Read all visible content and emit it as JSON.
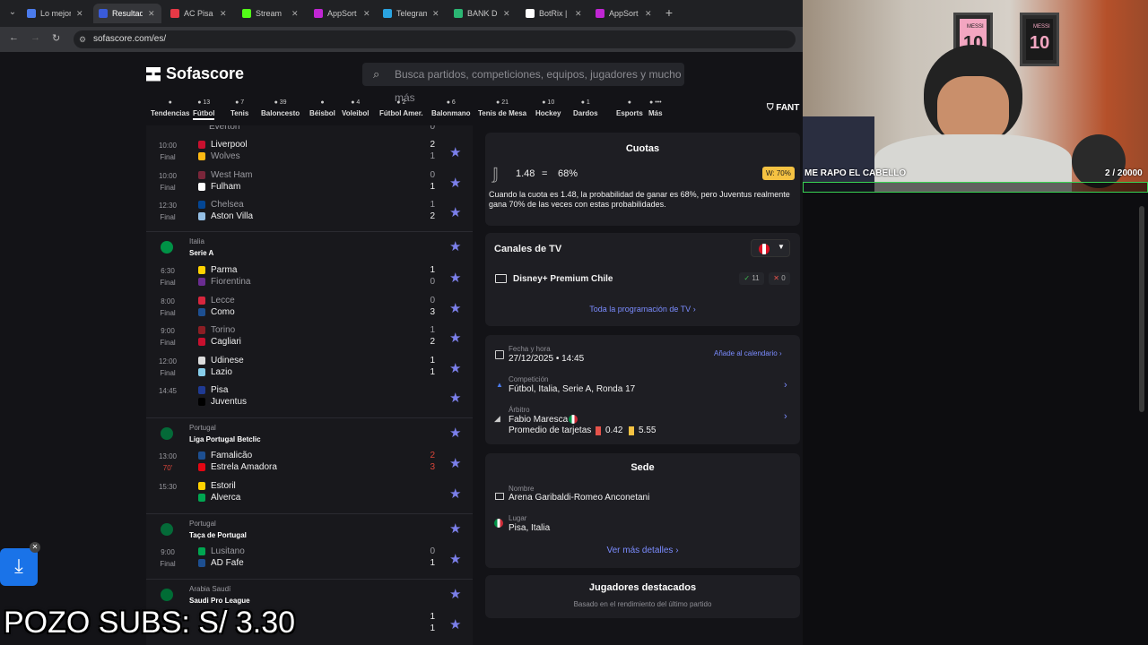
{
  "browser": {
    "tabs": [
      {
        "label": "Lo mejor",
        "color": "#4b7bec"
      },
      {
        "label": "Resultad",
        "color": "#3a5bd9",
        "active": true
      },
      {
        "label": "AC Pisa",
        "color": "#e63946"
      },
      {
        "label": "Stream",
        "color": "#53fc18"
      },
      {
        "label": "AppSort",
        "color": "#c026d3"
      },
      {
        "label": "Telegram",
        "color": "#2aa3e0"
      },
      {
        "label": "BANK Di",
        "color": "#2bb673"
      },
      {
        "label": "BotRix |",
        "color": "#ffffff"
      },
      {
        "label": "AppSort",
        "color": "#c026d3"
      }
    ],
    "new_tab": "+",
    "url": "sofascore.com/es/"
  },
  "site": {
    "logo": "Sofascore",
    "search_placeholder": "Busca partidos, competiciones, equipos, jugadores y mucho más",
    "fantasy": "FANT",
    "sports": [
      {
        "label": "Tendencias",
        "count": ""
      },
      {
        "label": "Fútbol",
        "count": "13",
        "active": true
      },
      {
        "label": "Tenis",
        "count": "7"
      },
      {
        "label": "Baloncesto",
        "count": "39"
      },
      {
        "label": "Béisbol",
        "count": ""
      },
      {
        "label": "Voleibol",
        "count": "4"
      },
      {
        "label": "Fútbol Amer.",
        "count": "2"
      },
      {
        "label": "Balonmano",
        "count": "6"
      },
      {
        "label": "Tenis de Mesa",
        "count": "21"
      },
      {
        "label": "Hockey",
        "count": "10"
      },
      {
        "label": "Dardos",
        "count": "1"
      },
      {
        "label": "Esports",
        "count": ""
      },
      {
        "label": "Más",
        "count": "•••"
      }
    ]
  },
  "matches": {
    "top_partial": "Everton",
    "group1": [
      {
        "t1": "10:00",
        "t2": "Final",
        "home": "Liverpool",
        "away": "Wolves",
        "hs": "2",
        "as": "1",
        "homeWin": true,
        "hc": "#c8102e",
        "ac": "#fdb913"
      },
      {
        "t1": "10:00",
        "t2": "Final",
        "home": "West Ham",
        "away": "Fulham",
        "hs": "0",
        "as": "1",
        "homeWin": false,
        "hc": "#7a263a",
        "ac": "#ffffff"
      },
      {
        "t1": "12:30",
        "t2": "Final",
        "home": "Chelsea",
        "away": "Aston Villa",
        "hs": "1",
        "as": "2",
        "homeWin": false,
        "hc": "#034694",
        "ac": "#95bfe5"
      }
    ],
    "italy": {
      "country": "Italia",
      "name": "Serie A",
      "flag": "#009246"
    },
    "group2": [
      {
        "t1": "6:30",
        "t2": "Final",
        "home": "Parma",
        "away": "Fiorentina",
        "hs": "1",
        "as": "0",
        "homeWin": true,
        "hc": "#ffd200",
        "ac": "#6a2c91"
      },
      {
        "t1": "8:00",
        "t2": "Final",
        "home": "Lecce",
        "away": "Como",
        "hs": "0",
        "as": "3",
        "homeWin": false,
        "hc": "#d7263d",
        "ac": "#1d4f91"
      },
      {
        "t1": "9:00",
        "t2": "Final",
        "home": "Torino",
        "away": "Cagliari",
        "hs": "1",
        "as": "2",
        "homeWin": false,
        "hc": "#8b1e24",
        "ac": "#c8102e"
      },
      {
        "t1": "12:00",
        "t2": "Final",
        "home": "Udinese",
        "away": "Lazio",
        "hs": "1",
        "as": "1",
        "homeWin": null,
        "hc": "#dddddd",
        "ac": "#87ceeb"
      },
      {
        "t1": "14:45",
        "t2": "",
        "home": "Pisa",
        "away": "Juventus",
        "hs": "",
        "as": "",
        "homeWin": null,
        "hc": "#1f3a93",
        "ac": "#000000",
        "upcoming": true
      }
    ],
    "portugal": {
      "country": "Portugal",
      "name": "Liga Portugal Betclic",
      "flag": "#046a38"
    },
    "group3": [
      {
        "t1": "13:00",
        "t2": "70'",
        "home": "Famalicão",
        "away": "Estrela Amadora",
        "hs": "2",
        "as": "3",
        "live": true,
        "hc": "#1d4f91",
        "ac": "#e30613"
      },
      {
        "t1": "15:30",
        "t2": "",
        "home": "Estoril",
        "away": "Alverca",
        "hs": "",
        "as": "",
        "upcoming": true,
        "hc": "#ffd200",
        "ac": "#00a651"
      }
    ],
    "portugal2": {
      "country": "Portugal",
      "name": "Taça de Portugal",
      "flag": "#046a38"
    },
    "group4": [
      {
        "t1": "9:00",
        "t2": "Final",
        "home": "Lusitano",
        "away": "AD Fafe",
        "hs": "0",
        "as": "1",
        "homeWin": false,
        "hc": "#00a651",
        "ac": "#1d4f91"
      }
    ],
    "saudi": {
      "country": "Arabia Saudí",
      "name": "Saudi Pro League",
      "flag": "#006c35"
    },
    "group5_scores": [
      "1",
      "1"
    ]
  },
  "odds": {
    "title": "Cuotas",
    "value": "1.48",
    "eq": "=",
    "pct": "68%",
    "badge": "W: 70%",
    "desc": "Cuando la cuota es 1.48, la probabilidad de ganar es 68%, pero Juventus realmente gana 70% de las veces con estas probabilidades."
  },
  "tv": {
    "title": "Canales de TV",
    "channel": "Disney+ Premium Chile",
    "up": "11",
    "down": "0",
    "link": "Toda la programación de TV"
  },
  "info": {
    "date_label": "Fecha y hora",
    "date_value": "27/12/2025  •  14:45",
    "calendar": "Añade al calendario",
    "comp_label": "Competición",
    "comp_value": "Fútbol, Italia, Serie A, Ronda 17",
    "ref_label": "Árbitro",
    "ref_value": "Fabio Maresca",
    "cards_label": "Promedio de tarjetas",
    "red": "0.42",
    "yellow": "5.55"
  },
  "venue": {
    "title": "Sede",
    "name_label": "Nombre",
    "name": "Arena Garibaldi-Romeo Anconetani",
    "place_label": "Lugar",
    "place": "Pisa, Italia",
    "link": "Ver más detalles"
  },
  "players": {
    "title": "Jugadores destacados",
    "sub": "Basado en el rendimiento del último partido"
  },
  "stream": {
    "cam_label": "ME RAPO EL CABELLO",
    "cam_count": "2  / 20000",
    "pozo": "POZO SUBS: S/ 3.30",
    "jersey1": "10",
    "jersey2": "10",
    "jersey_name": "MESSI"
  }
}
